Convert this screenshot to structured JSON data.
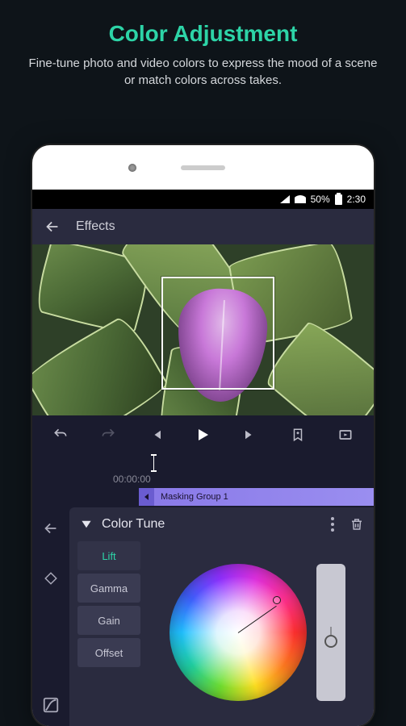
{
  "promo": {
    "title": "Color Adjustment",
    "subtitle": "Fine-tune photo and video colors to express the mood of a scene or match colors across takes."
  },
  "status": {
    "battery": "50%",
    "time": "2:30"
  },
  "header": {
    "title": "Effects"
  },
  "timeline": {
    "timecode": "00:00:00",
    "clip_label": "Masking Group 1"
  },
  "panel": {
    "title": "Color Tune",
    "tabs": {
      "lift": "Lift",
      "gamma": "Gamma",
      "gain": "Gain",
      "offset": "Offset"
    },
    "active_tab": "lift"
  }
}
